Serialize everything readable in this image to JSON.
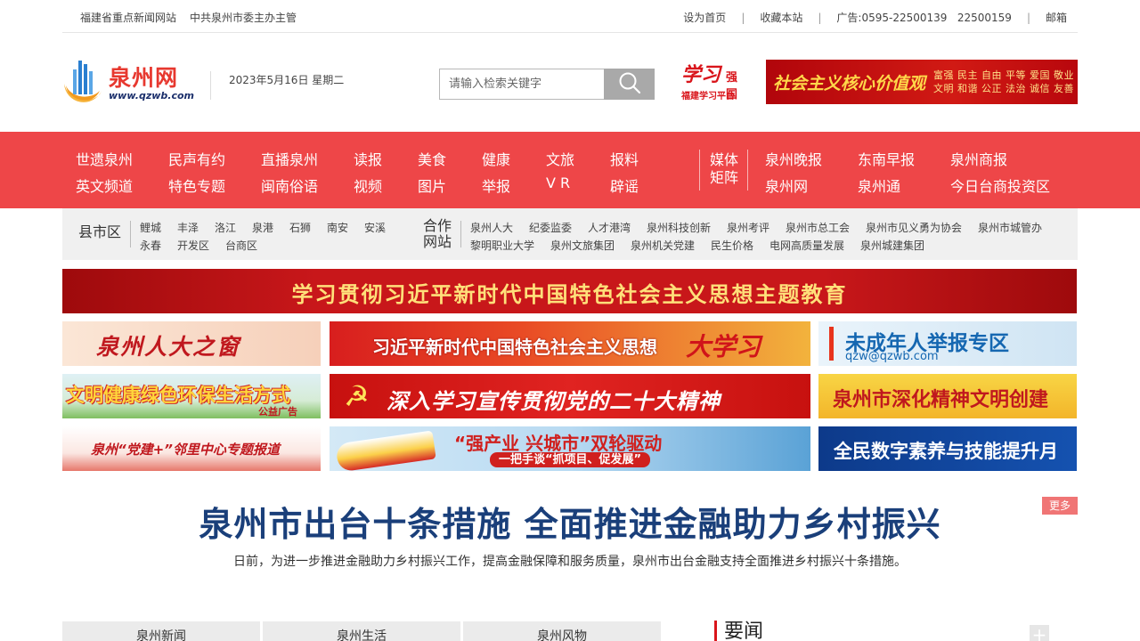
{
  "topbar": {
    "left_1": "福建省重点新闻网站",
    "left_2": "中共泉州市委主办主管",
    "set_home": "设为首页",
    "bookmark": "收藏本站",
    "ad": "广告:0595-22500139   22500159",
    "mail": "邮箱",
    "sep": "|"
  },
  "header": {
    "logo_name": "泉州网",
    "logo_url": "www.qzwb.com",
    "date": "2023年5月16日 星期二",
    "search_placeholder": "请输入检索关键字",
    "xuexi_big": "学习",
    "xuexi_q": "强国",
    "xuexi_sub": "福建学习平台",
    "values_main": "社会主义核心价值观",
    "values_small": "富强 民主 自由 平等 爱国 敬业 文明 和谐 公正 法治 诚信 友善"
  },
  "nav": {
    "row1": [
      "世遗泉州",
      "民声有约",
      "直播泉州",
      "读报",
      "美食",
      "健康",
      "文旅",
      "报料"
    ],
    "row2": [
      "英文频道",
      "特色专题",
      "闽南俗语",
      "视频",
      "图片",
      "举报",
      "V R",
      "辟谣"
    ],
    "media_label": "媒体矩阵",
    "media_row1": [
      "泉州晚报",
      "东南早报",
      "泉州商报"
    ],
    "media_row2": [
      "泉州网",
      "泉州通",
      "今日台商投资区"
    ]
  },
  "subnav": {
    "county_label": "县市区",
    "county_row1": [
      "鲤城",
      "丰泽",
      "洛江",
      "泉港",
      "石狮",
      "南安",
      "安溪"
    ],
    "county_row2": [
      "永春",
      "开发区",
      "台商区"
    ],
    "partner_label": "合作网站",
    "partner_row1": [
      "泉州人大",
      "纪委监委",
      "人才港湾",
      "泉州科技创新",
      "泉州考评",
      "泉州市总工会",
      "泉州市见义勇为协会",
      "泉州市城管办"
    ],
    "partner_row2": [
      "黎明职业大学",
      "泉州文旅集团",
      "泉州机关党建",
      "民生价格",
      "电网高质量发展",
      "泉州城建集团"
    ]
  },
  "banners": {
    "main": "学习贯彻习近平新时代中国特色社会主义思想主题教育",
    "b1": "泉州人大之窗",
    "b2": "习近平新时代中国特色社会主义思想",
    "b2_big": "大学习",
    "b3": "未成年人举报专区",
    "b3_email": "qzw@qzwb.com",
    "b4": "文明健康绿色环保生活方式",
    "b4_tag": "公益广告",
    "b5": "深入学习宣传贯彻党的二十大精神",
    "b6": "泉州市深化精神文明创建",
    "b7": "泉州“党建+”邻里中心专题报道",
    "b8": "“强产业 兴城市”双轮驱动",
    "b8_sub": "一把手谈“抓项目、促发展”",
    "b9": "全民数字素养与技能提升月"
  },
  "headline": {
    "title": "泉州市出台十条措施 全面推进金融助力乡村振兴",
    "summary": "日前，为进一步推进金融助力乡村振兴工作，提高金融保障和服务质量，泉州市出台金融支持全面推进乡村振兴十条措施。",
    "more": "更多"
  },
  "tabs": [
    "泉州新闻",
    "泉州生活",
    "泉州风物"
  ],
  "yaowen": "要闻",
  "plus": "+"
}
